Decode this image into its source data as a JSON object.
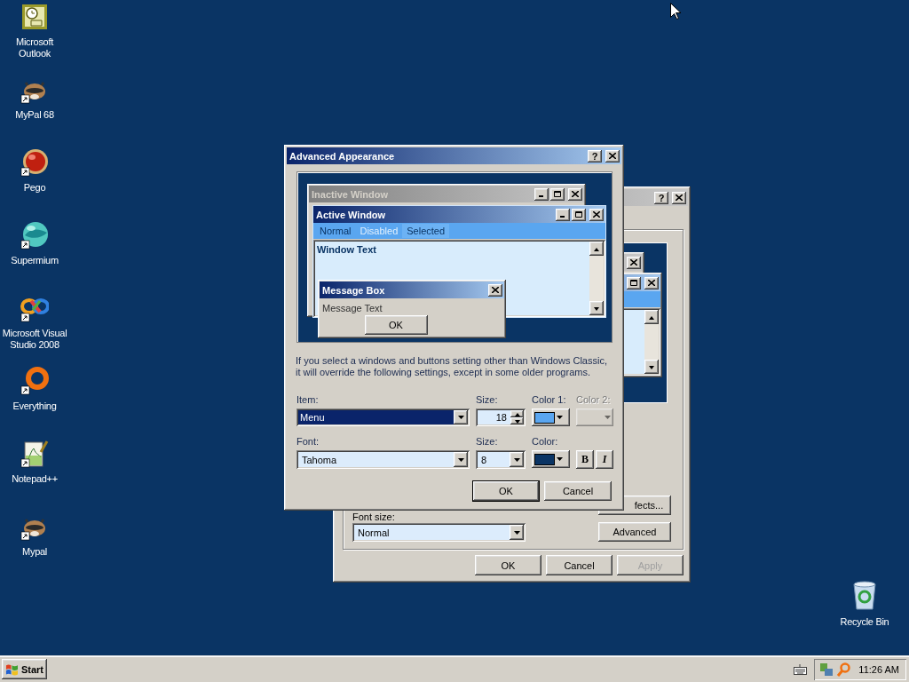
{
  "desktop_icons": [
    {
      "label": "Microsoft Outlook",
      "kind": "clock",
      "shortcut": false
    },
    {
      "label": "MyPal 68",
      "kind": "raccoon",
      "shortcut": true
    },
    {
      "label": "Pego",
      "kind": "ball",
      "shortcut": true
    },
    {
      "label": "Supermium",
      "kind": "globe",
      "shortcut": true
    },
    {
      "label": "Microsoft Visual Studio 2008",
      "kind": "infinity",
      "shortcut": true
    },
    {
      "label": "Everything",
      "kind": "ring",
      "shortcut": true
    },
    {
      "label": "Notepad++",
      "kind": "notepad",
      "shortcut": true
    },
    {
      "label": "Mypal",
      "kind": "raccoon",
      "shortcut": true
    }
  ],
  "recycle_bin": {
    "label": "Recycle Bin"
  },
  "back_window": {
    "help_button": "?",
    "effects_button": "fects...",
    "font_size_label": "Font size:",
    "font_size": "Normal",
    "advanced_button": "Advanced",
    "buttons": [
      {
        "label": "OK",
        "disabled": false
      },
      {
        "label": "Cancel",
        "disabled": false
      },
      {
        "label": "Apply",
        "disabled": true
      }
    ]
  },
  "dialog": {
    "title": "Advanced Appearance",
    "help_button": "?",
    "preview": {
      "inactive_title": "Inactive Window",
      "active_title": "Active Window",
      "menu": [
        {
          "label": "Normal",
          "disabled": false,
          "selected": false
        },
        {
          "label": "Disabled",
          "disabled": true,
          "selected": false
        },
        {
          "label": "Selected",
          "disabled": false,
          "selected": true
        }
      ],
      "window_text": "Window Text",
      "message_box": {
        "title": "Message Box",
        "text": "Message Text",
        "button": "OK"
      }
    },
    "note": "If you select a windows and buttons setting other than Windows Classic, it will override the following settings, except in some older programs.",
    "item": {
      "label": "Item:",
      "value": "Menu"
    },
    "item_size": {
      "label": "Size:",
      "value": "18"
    },
    "color1": {
      "label": "Color 1:",
      "color": "#5aa6f0",
      "disabled": false
    },
    "color2": {
      "label": "Color 2:",
      "disabled": true
    },
    "font": {
      "label": "Font:",
      "value": "Tahoma"
    },
    "font_size": {
      "label": "Size:",
      "value": "8"
    },
    "font_color": {
      "label": "Color:",
      "color": "#0a3464",
      "disabled": false
    },
    "bold_button": {
      "label": "B",
      "selected": false
    },
    "italic_button": {
      "label": "I",
      "selected": false
    },
    "buttons": [
      {
        "label": "OK",
        "default": true
      },
      {
        "label": "Cancel",
        "default": false
      }
    ]
  },
  "taskbar": {
    "start": "Start",
    "clock": "11:26 AM"
  }
}
